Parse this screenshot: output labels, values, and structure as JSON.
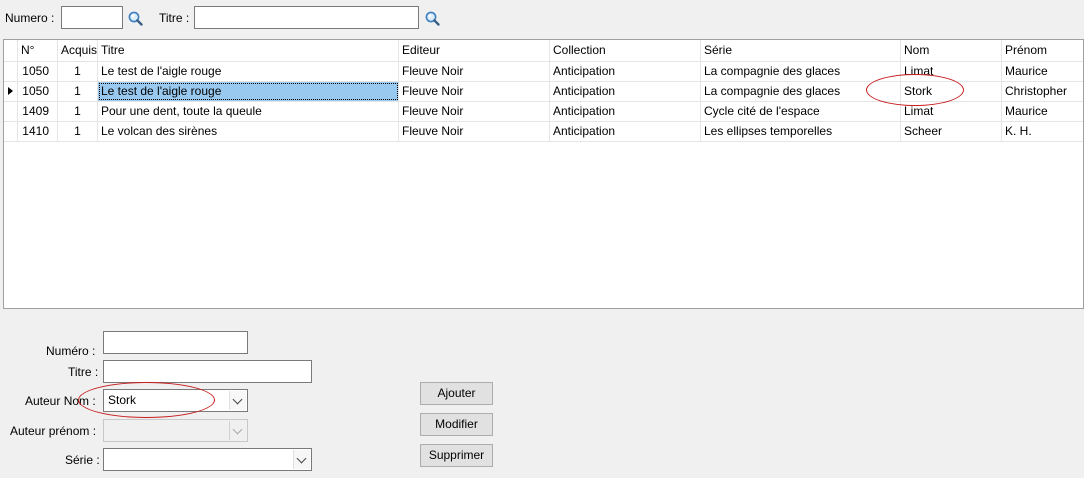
{
  "search": {
    "numero_label": "Numero :",
    "numero_value": "",
    "titre_label": "Titre :",
    "titre_value": ""
  },
  "grid": {
    "columns": [
      "N°",
      "Acquis",
      "Titre",
      "Editeur",
      "Collection",
      "Série",
      "Nom",
      "Prénom"
    ],
    "rows": [
      [
        "1050",
        "1",
        "Le test de l'aigle rouge",
        "Fleuve Noir",
        "Anticipation",
        "La compagnie des glaces",
        "Limat",
        "Maurice"
      ],
      [
        "1050",
        "1",
        "Le test de l'aigle rouge",
        "Fleuve Noir",
        "Anticipation",
        "La compagnie des glaces",
        "Stork",
        "Christopher"
      ],
      [
        "1409",
        "1",
        "Pour une dent, toute la queule",
        "Fleuve Noir",
        "Anticipation",
        "Cycle cité de l'espace",
        "Limat",
        "Maurice"
      ],
      [
        "1410",
        "1",
        "Le volcan des sirènes",
        "Fleuve Noir",
        "Anticipation",
        "Les ellipses temporelles",
        "Scheer",
        "K. H."
      ]
    ],
    "selected_row": 1
  },
  "form": {
    "numero_label": "Numéro :",
    "numero_value": "",
    "titre_label": "Titre :",
    "titre_value": "",
    "auteur_nom_label": "Auteur Nom :",
    "auteur_nom_value": "Stork",
    "auteur_prenom_label": "Auteur prénom :",
    "auteur_prenom_value": "",
    "serie_label": "Série :",
    "serie_value": ""
  },
  "buttons": {
    "ajouter": "Ajouter",
    "modifier": "Modifier",
    "supprimer": "Supprimer"
  },
  "icons": {
    "search": "search-icon",
    "row_pointer": "row-pointer-icon",
    "dropdown": "chevron-down-icon"
  },
  "colors": {
    "background": "#f0f0f0",
    "selection": "#99c9ef",
    "annotation": "#c81e1e"
  }
}
